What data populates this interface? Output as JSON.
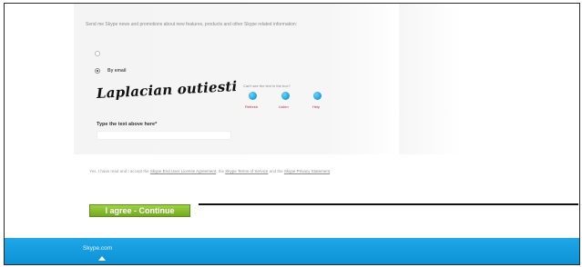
{
  "marketing": {
    "text": "Send me Skype news and promotions about new features, products and other Skype related information:"
  },
  "options": [
    {
      "label": ""
    },
    {
      "label": "By email"
    }
  ],
  "captcha": {
    "challenge": "Laplacian outiesti",
    "cant_see": "Can't see the text in the box?",
    "refresh_label": "Refresh",
    "listen_label": "Listen",
    "help_label": "Help",
    "type_label": "Type the text above here*",
    "input_value": ""
  },
  "terms": {
    "prefix": "Yes, I have read and I accept the ",
    "link1": "Skype End User License Agreement",
    "mid": ", the ",
    "link2": "Skype Terms of Service",
    "mid2": " and the ",
    "link3": "Skype Privacy Statement",
    "suffix": "."
  },
  "agree_button": {
    "label": "I agree - Continue"
  },
  "footer": {
    "label": "Skype.com"
  },
  "colors": {
    "button_green": "#8cc63f",
    "footer_blue": "#12a0e3",
    "annotation_line": "#111111"
  },
  "icons": {
    "refresh": "refresh-icon",
    "listen": "listen-icon",
    "help": "help-icon"
  }
}
